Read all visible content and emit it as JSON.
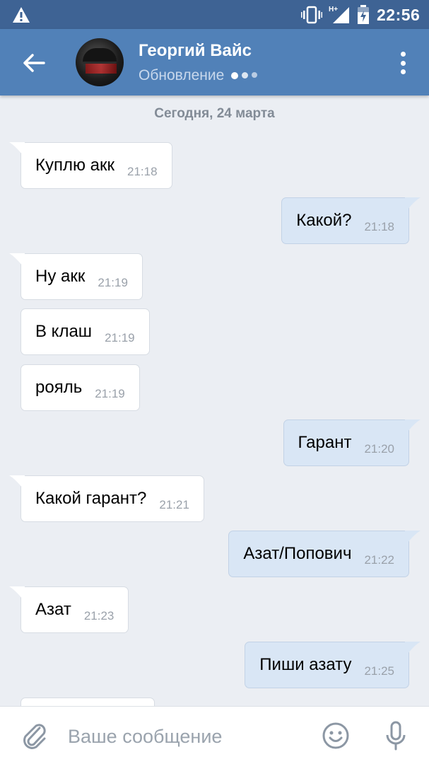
{
  "status_bar": {
    "time": "22:56",
    "network": "H+",
    "battery_level": 0.7
  },
  "header": {
    "name": "Георгий Вайс",
    "status": "Обновление"
  },
  "chat": {
    "date_separator": "Сегодня, 24 марта",
    "messages": [
      {
        "dir": "in",
        "text": "Куплю акк",
        "time": "21:18"
      },
      {
        "dir": "out",
        "text": "Какой?",
        "time": "21:18"
      },
      {
        "dir": "in",
        "text": "Ну акк",
        "time": "21:19"
      },
      {
        "dir": "in",
        "text": "В клаш",
        "time": "21:19"
      },
      {
        "dir": "in",
        "text": "рояль",
        "time": "21:19"
      },
      {
        "dir": "out",
        "text": "Гарант",
        "time": "21:20"
      },
      {
        "dir": "in",
        "text": "Какой гарант?",
        "time": "21:21"
      },
      {
        "dir": "out",
        "text": "Азат/Попович",
        "time": "21:22"
      },
      {
        "dir": "in",
        "text": "Азат",
        "time": "21:23"
      },
      {
        "dir": "out",
        "text": "Пиши азату",
        "time": "21:25"
      }
    ]
  },
  "input": {
    "placeholder": "Ваше сообщение"
  },
  "colors": {
    "status_bar": "#3e6394",
    "header": "#5181b8",
    "background": "#ebeef3",
    "bubble_in": "#ffffff",
    "bubble_out": "#d9e6f5"
  }
}
